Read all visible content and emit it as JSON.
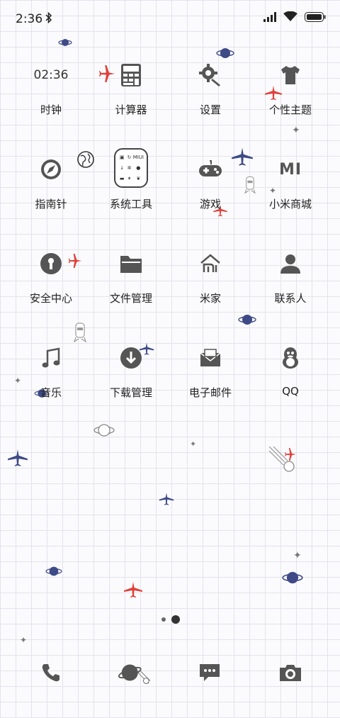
{
  "status_bar": {
    "time": "2:36"
  },
  "apps": [
    {
      "id": "clock",
      "label": "时钟",
      "icon": "clock-icon",
      "icon_text": "02:36"
    },
    {
      "id": "calculator",
      "label": "计算器",
      "icon": "calculator-icon"
    },
    {
      "id": "settings",
      "label": "设置",
      "icon": "gear-icon"
    },
    {
      "id": "themes",
      "label": "个性主题",
      "icon": "shirt-icon"
    },
    {
      "id": "compass",
      "label": "指南针",
      "icon": "compass-icon"
    },
    {
      "id": "system_tools",
      "label": "系统工具",
      "icon": "folder-icon"
    },
    {
      "id": "games",
      "label": "游戏",
      "icon": "gamepad-icon"
    },
    {
      "id": "mi_store",
      "label": "小米商城",
      "icon": "mi-logo-icon",
      "icon_text": "MI"
    },
    {
      "id": "security",
      "label": "安全中心",
      "icon": "shield-icon"
    },
    {
      "id": "file_manager",
      "label": "文件管理",
      "icon": "folder-open-icon"
    },
    {
      "id": "mi_home",
      "label": "米家",
      "icon": "home-icon"
    },
    {
      "id": "contacts",
      "label": "联系人",
      "icon": "person-icon"
    },
    {
      "id": "music",
      "label": "音乐",
      "icon": "music-note-icon"
    },
    {
      "id": "downloads",
      "label": "下载管理",
      "icon": "download-icon"
    },
    {
      "id": "email",
      "label": "电子邮件",
      "icon": "mail-icon"
    },
    {
      "id": "qq",
      "label": "QQ",
      "icon": "penguin-icon"
    }
  ],
  "system_tools_folder": {
    "mini_text": "MIUI"
  },
  "dock": [
    {
      "id": "phone",
      "icon": "phone-icon"
    },
    {
      "id": "browser",
      "icon": "planet-icon"
    },
    {
      "id": "messages",
      "icon": "chat-bubble-icon"
    },
    {
      "id": "camera",
      "icon": "camera-icon"
    }
  ],
  "page_indicator": {
    "pages": 2,
    "current": 2
  },
  "colors": {
    "accent_red": "#e0403a",
    "accent_blue": "#3e4a86",
    "icon_gray": "#555555"
  }
}
